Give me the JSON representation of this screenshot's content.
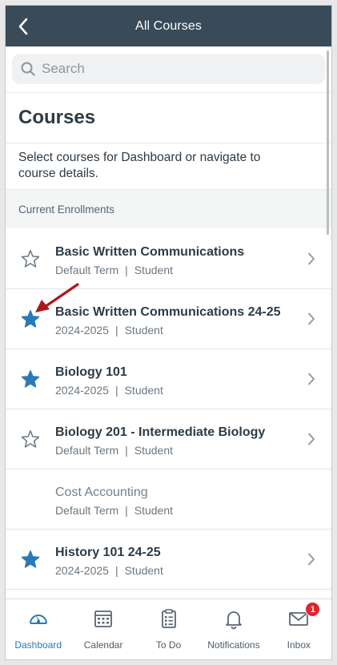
{
  "navbar": {
    "title": "All Courses",
    "back_icon": "chevron-left-icon"
  },
  "search": {
    "placeholder": "Search",
    "value": ""
  },
  "page": {
    "heading": "Courses",
    "description": "Select courses for Dashboard or navigate to course details.",
    "section_header": "Current Enrollments"
  },
  "courses": [
    {
      "name": "Basic Written Communications",
      "term": "Default Term",
      "role": "Student",
      "favorited": false,
      "has_star": true,
      "has_chevron": true,
      "muted": false
    },
    {
      "name": "Basic Written Communications 24-25",
      "term": "2024-2025",
      "role": "Student",
      "favorited": true,
      "has_star": true,
      "has_chevron": true,
      "muted": false
    },
    {
      "name": "Biology 101",
      "term": "2024-2025",
      "role": "Student",
      "favorited": true,
      "has_star": true,
      "has_chevron": true,
      "muted": false
    },
    {
      "name": "Biology 201 - Intermediate Biology",
      "term": "Default Term",
      "role": "Student",
      "favorited": false,
      "has_star": true,
      "has_chevron": true,
      "muted": false
    },
    {
      "name": "Cost Accounting",
      "term": "Default Term",
      "role": "Student",
      "favorited": false,
      "has_star": false,
      "has_chevron": false,
      "muted": true
    },
    {
      "name": "History 101 24-25",
      "term": "2024-2025",
      "role": "Student",
      "favorited": true,
      "has_star": true,
      "has_chevron": true,
      "muted": false
    }
  ],
  "meta_separator": "|",
  "tabbar": {
    "tabs": [
      {
        "label": "Dashboard",
        "icon": "dashboard-icon",
        "active": true
      },
      {
        "label": "Calendar",
        "icon": "calendar-icon",
        "active": false
      },
      {
        "label": "To Do",
        "icon": "todo-clipboard-icon",
        "active": false
      },
      {
        "label": "Notifications",
        "icon": "bell-icon",
        "active": false
      },
      {
        "label": "Inbox",
        "icon": "inbox-envelope-icon",
        "active": false,
        "badge": "1"
      }
    ]
  },
  "colors": {
    "navbar_bg": "#394b58",
    "star_filled": "#2a7ab8",
    "active_tab": "#2a7ab8",
    "badge": "#e0242e",
    "annotation_arrow": "#b0161b"
  }
}
